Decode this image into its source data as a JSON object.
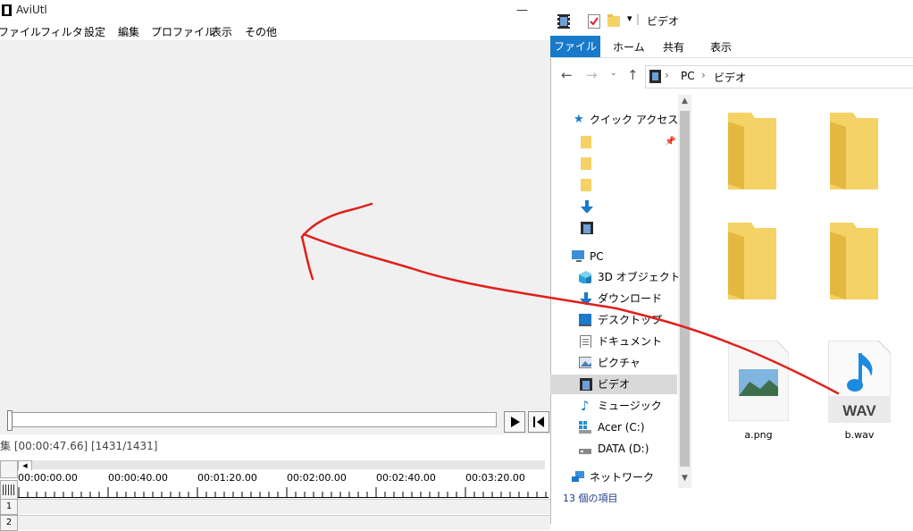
{
  "aviutl": {
    "title": "AviUtl",
    "window_controls": "—",
    "menu": [
      "ファイル",
      "フィルタ",
      "設定",
      "編集",
      "プロファイル",
      "表示",
      "その他"
    ],
    "timeline_status": "集 [00:00:47.66] [1431/1431]",
    "timeline_ticks": [
      "00:00:00.00",
      "00:00:40.00",
      "00:01:20.00",
      "00:02:00.00",
      "00:02:40.00",
      "00:03:20.00"
    ],
    "layers": [
      "1",
      "2"
    ]
  },
  "explorer": {
    "title": "ビデオ",
    "ribbon_tabs": {
      "file": "ファイル",
      "home": "ホーム",
      "share": "共有",
      "view": "表示"
    },
    "path": [
      "PC",
      "ビデオ"
    ],
    "nav": {
      "quick_access": "クイック アクセス",
      "pc": "PC",
      "objects3d": "3D オブジェクト",
      "downloads": "ダウンロード",
      "desktop": "デスクトップ",
      "documents": "ドキュメント",
      "pictures": "ピクチャ",
      "videos": "ビデオ",
      "music": "ミュージック",
      "acer": "Acer (C:)",
      "data": "DATA (D:)",
      "network": "ネットワーク"
    },
    "files": {
      "png": "a.png",
      "wav": "b.wav"
    },
    "wav_badge": "WAV",
    "status": "13 個の項目"
  },
  "colors": {
    "accent": "#1979ca",
    "annotation": "#e0201c",
    "folder": "#f5d266"
  }
}
